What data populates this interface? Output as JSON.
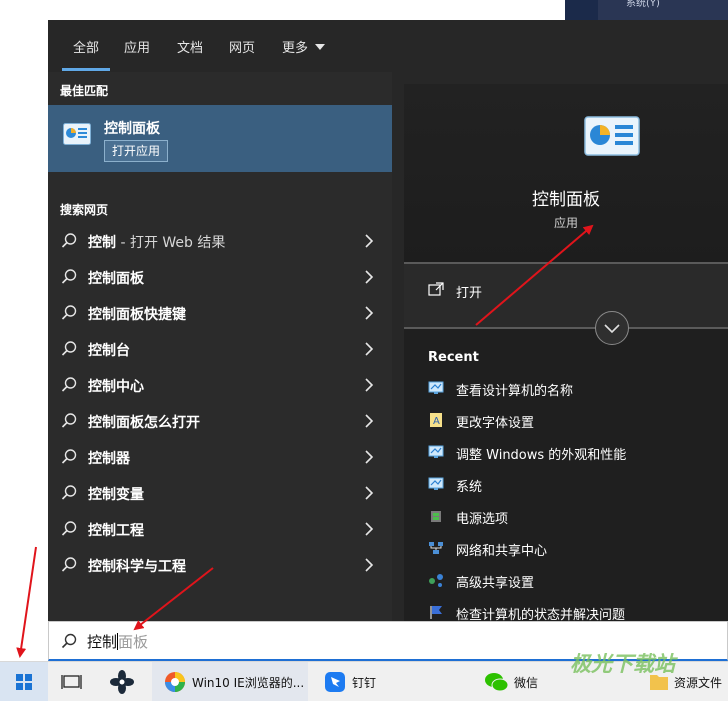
{
  "background": {
    "top_window_label": "系统(Y)"
  },
  "tabs": [
    {
      "label": "全部",
      "active": true
    },
    {
      "label": "应用"
    },
    {
      "label": "文档"
    },
    {
      "label": "网页"
    },
    {
      "label": "更多"
    }
  ],
  "left": {
    "best_match_title": "最佳匹配",
    "best_match": {
      "name": "控制面板",
      "button": "打开应用"
    },
    "web_title": "搜索网页",
    "web_results": [
      {
        "bold": "控制",
        "rest": " - 打开 Web 结果"
      },
      {
        "bold": "控制面板",
        "rest": ""
      },
      {
        "bold": "控制面板快捷键",
        "rest": ""
      },
      {
        "bold": "控制台",
        "rest": ""
      },
      {
        "bold": "控制中心",
        "rest": ""
      },
      {
        "bold": "控制面板怎么打开",
        "rest": ""
      },
      {
        "bold": "控制器",
        "rest": ""
      },
      {
        "bold": "控制变量",
        "rest": ""
      },
      {
        "bold": "控制工程",
        "rest": ""
      },
      {
        "bold": "控制科学与工程",
        "rest": ""
      }
    ]
  },
  "right": {
    "title": "控制面板",
    "subtitle": "应用",
    "open_label": "打开",
    "recent_title": "Recent",
    "recent": [
      {
        "label": "查看设计算机的名称",
        "icon": "monitor-icon"
      },
      {
        "label": "更改字体设置",
        "icon": "font-icon"
      },
      {
        "label": "调整 Windows 的外观和性能",
        "icon": "monitor-icon"
      },
      {
        "label": "系统",
        "icon": "monitor-icon"
      },
      {
        "label": "电源选项",
        "icon": "power-icon"
      },
      {
        "label": "网络和共享中心",
        "icon": "network-icon"
      },
      {
        "label": "高级共享设置",
        "icon": "share-icon"
      },
      {
        "label": "检查计算机的状态并解决问题",
        "icon": "flag-icon"
      }
    ]
  },
  "search": {
    "typed": "控制",
    "hint": "面板"
  },
  "taskbar": {
    "items": [
      {
        "label": "Win10 IE浏览器的...",
        "icon": "browser-icon"
      },
      {
        "label": "钉钉",
        "icon": "dingtalk-icon"
      },
      {
        "label": "微信",
        "icon": "wechat-icon"
      },
      {
        "label": "资源文件",
        "icon": "folder-icon"
      }
    ]
  },
  "watermark": "极光下载站",
  "colors": {
    "accent": "#60a8e6",
    "selected": "#3a5f80",
    "annotation": "#e0141b"
  }
}
